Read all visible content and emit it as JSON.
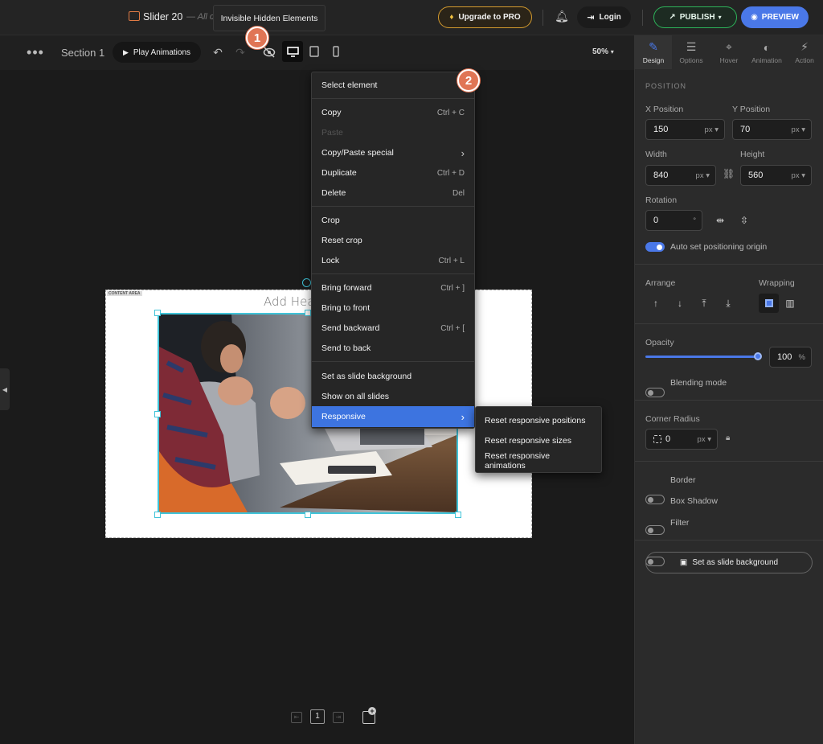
{
  "topbar": {
    "app_title": "Slider 20",
    "autosave_text": "All c",
    "upgrade_label": "Upgrade to PRO",
    "login_label": "Login",
    "publish_label": "PUBLISH",
    "preview_label": "PREVIEW",
    "tooltip": "Invisible Hidden Elements"
  },
  "badges": {
    "one": "1",
    "two": "2"
  },
  "toolbar": {
    "section_label": "Section 1",
    "play_label": "Play Animations",
    "zoom": "50%"
  },
  "canvas": {
    "heading_text": "Add Hea",
    "content_area_tag": "CONTENT AREA",
    "slide_number": "1"
  },
  "context_menu": {
    "header": "Select element",
    "items": [
      {
        "label": "Copy",
        "shortcut": "Ctrl + C"
      },
      {
        "label": "Paste",
        "shortcut": ""
      },
      {
        "label": "Copy/Paste special",
        "shortcut": "›"
      },
      {
        "label": "Duplicate",
        "shortcut": "Ctrl + D"
      },
      {
        "label": "Delete",
        "shortcut": "Del"
      },
      {
        "label": "Crop",
        "shortcut": ""
      },
      {
        "label": "Reset crop",
        "shortcut": ""
      },
      {
        "label": "Lock",
        "shortcut": "Ctrl + L"
      },
      {
        "label": "Bring forward",
        "shortcut": "Ctrl + ]"
      },
      {
        "label": "Bring to front",
        "shortcut": ""
      },
      {
        "label": "Send backward",
        "shortcut": "Ctrl + ["
      },
      {
        "label": "Send to back",
        "shortcut": ""
      },
      {
        "label": "Set as slide background",
        "shortcut": ""
      },
      {
        "label": "Show on all slides",
        "shortcut": ""
      },
      {
        "label": "Responsive",
        "shortcut": "›"
      }
    ]
  },
  "submenu": {
    "items": [
      "Reset responsive positions",
      "Reset responsive sizes",
      "Reset responsive animations"
    ]
  },
  "panel": {
    "tabs": [
      "Design",
      "Options",
      "Hover",
      "Animation",
      "Action"
    ],
    "position_header": "POSITION",
    "x_label": "X Position",
    "x_value": "150",
    "x_unit": "px",
    "y_label": "Y Position",
    "y_value": "70",
    "y_unit": "px",
    "width_label": "Width",
    "width_value": "840",
    "width_unit": "px",
    "height_label": "Height",
    "height_value": "560",
    "height_unit": "px",
    "rotation_label": "Rotation",
    "rotation_value": "0",
    "rotation_unit": "°",
    "auto_origin_label": "Auto set positioning origin",
    "arrange_label": "Arrange",
    "wrapping_label": "Wrapping",
    "opacity_label": "Opacity",
    "opacity_value": "100",
    "opacity_unit": "%",
    "blending_label": "Blending mode",
    "corner_label": "Corner Radius",
    "corner_value": "0",
    "corner_unit": "px",
    "border_label": "Border",
    "shadow_label": "Box Shadow",
    "filter_label": "Filter",
    "set_bg_label": "Set as slide background"
  },
  "colors": {
    "accent": "#4a78e8",
    "publish": "#2db45a",
    "upgrade": "#d49b2e",
    "badge": "#e07555",
    "selection": "#3fc3d8"
  }
}
